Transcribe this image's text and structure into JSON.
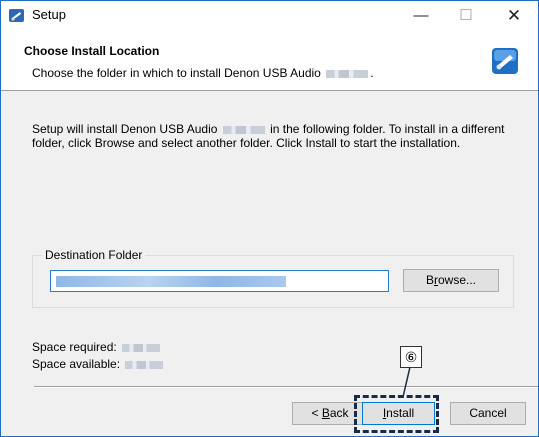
{
  "window": {
    "title": "Setup",
    "minimize_glyph": "—",
    "maximize_glyph": "☐",
    "close_glyph": "✕"
  },
  "header": {
    "title": "Choose Install Location",
    "subtitle": "Choose the folder in which to install Denon USB Audio",
    "subtitle_end": ".",
    "icon": "installer-disk-icon"
  },
  "intro": {
    "part1": "Setup will install Denon USB Audio",
    "part2": "in the following folder. To install in a different folder, click Browse and select another folder. Click Install to start the installation."
  },
  "destination": {
    "legend": "Destination Folder",
    "browse_label_pre": "B",
    "browse_label_ul": "r",
    "browse_label_post": "owse..."
  },
  "space": {
    "required_label": "Space required:",
    "available_label": "Space available:"
  },
  "buttons": {
    "back_pre": "< ",
    "back_ul": "B",
    "back_post": "ack",
    "install_ul": "I",
    "install_post": "nstall",
    "cancel": "Cancel"
  },
  "callout": {
    "label": "⑥"
  },
  "colors": {
    "accent": "#0078d7",
    "callout": "#1a2b4a"
  }
}
